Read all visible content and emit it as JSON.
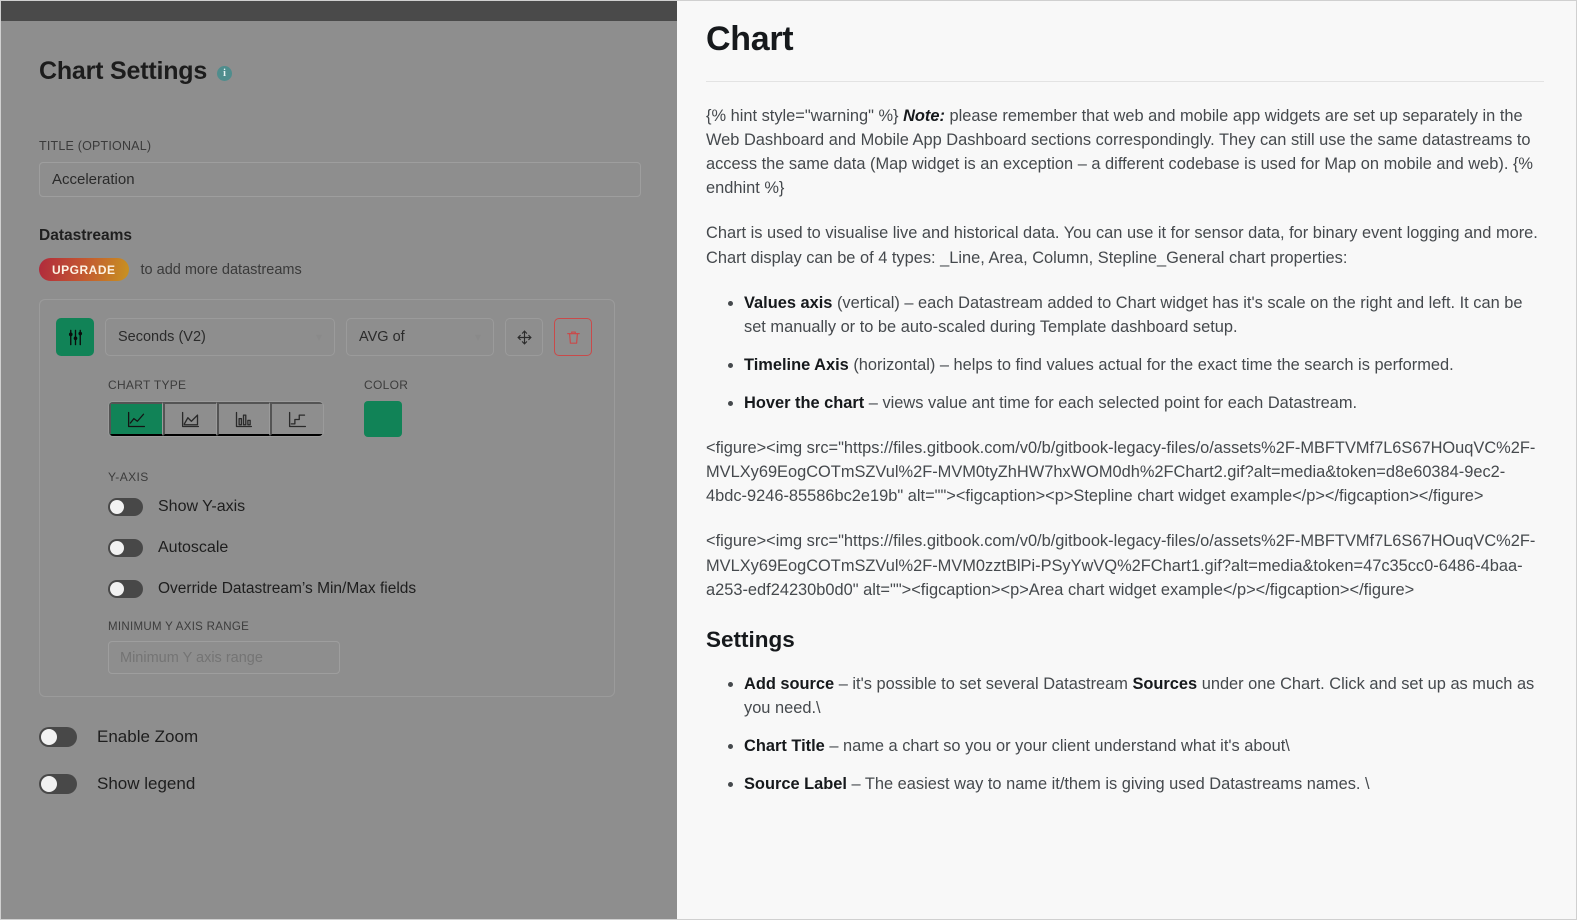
{
  "left_panel": {
    "title": "Chart Settings",
    "info_icon": "info-icon",
    "title_field": {
      "label": "TITLE (OPTIONAL)",
      "value": "Acceleration"
    },
    "datastreams": {
      "heading": "Datastreams",
      "upgrade_badge": "UPGRADE",
      "upgrade_note": "to add more datastreams",
      "row": {
        "settings_icon": "sliders-icon",
        "datastream_select": "Seconds (V2)",
        "aggregation_select": "AVG of",
        "move_icon": "move-icon",
        "delete_icon": "trash-icon"
      },
      "chart_type": {
        "label": "CHART TYPE",
        "options": [
          "line-chart-icon",
          "area-chart-icon",
          "column-chart-icon",
          "stepline-chart-icon"
        ],
        "selected_index": 0
      },
      "color": {
        "label": "COLOR",
        "value": "#118357"
      },
      "y_axis": {
        "label": "Y-AXIS",
        "toggles": [
          {
            "label": "Show Y-axis",
            "on": false
          },
          {
            "label": "Autoscale",
            "on": false
          },
          {
            "label": "Override Datastream’s Min/Max fields",
            "on": false
          }
        ],
        "min_range": {
          "label": "MINIMUM Y AXIS RANGE",
          "value": "",
          "placeholder": "Minimum Y axis range"
        }
      }
    },
    "bottom_toggles": [
      {
        "label": "Enable Zoom",
        "on": false
      },
      {
        "label": "Show legend",
        "on": false
      }
    ]
  },
  "right_panel": {
    "title": "Chart",
    "note_paragraph": {
      "prefix": "{% hint style=\"warning\" %} ",
      "note_label": "Note:",
      "body": " please remember that web and mobile app widgets are set up separately in the Web Dashboard and Mobile App Dashboard sections correspondingly. They can still use the same datastreams to access the same data (Map widget is an exception – a different codebase is used for Map on mobile and web). {% endhint %}"
    },
    "intro_paragraph": "Chart is used to visualise live and historical data. You can use it for sensor data, for binary event logging and more. Chart display can be of 4 types: _Line, Area, Column, Stepline_General chart properties:",
    "properties_list": [
      {
        "term": "Values axis",
        "desc": " (vertical) – each Datastream added to Chart widget has it's scale on the right and left. It can be set manually or to be auto-scaled during Template dashboard setup."
      },
      {
        "term": "Timeline Axis",
        "desc": " (horizontal) – helps to find values actual for the exact time the search is performed."
      },
      {
        "term": "Hover the chart",
        "desc": " – views value ant time for each selected point for each Datastream."
      }
    ],
    "figure_block_1": "<figure><img src=\"https://files.gitbook.com/v0/b/gitbook-legacy-files/o/assets%2F-MBFTVMf7L6S67HOuqVC%2F-MVLXy69EogCOTmSZVul%2F-MVM0tyZhHW7hxWOM0dh%2FChart2.gif?alt=media&token=d8e60384-9ec2-4bdc-9246-85586bc2e19b\" alt=\"\"><figcaption><p>Stepline chart widget example</p></figcaption></figure>",
    "figure_block_2": "<figure><img src=\"https://files.gitbook.com/v0/b/gitbook-legacy-files/o/assets%2F-MBFTVMf7L6S67HOuqVC%2F-MVLXy69EogCOTmSZVul%2F-MVM0zztBlPi-PSyYwVQ%2FChart1.gif?alt=media&token=47c35cc0-6486-4baa-a253-edf24230b0d0\" alt=\"\"><figcaption><p>Area chart widget example</p></figcaption></figure>",
    "settings_heading": "Settings",
    "settings_list": [
      {
        "term": "Add source",
        "desc_before": " – it's possible to set several Datastream ",
        "term2": "Sources",
        "desc_after": " under one Chart. Click and set up as much as you need.\\"
      },
      {
        "term": "Chart Title",
        "desc_before": " – name a chart so you or your client understand what it's about\\",
        "term2": "",
        "desc_after": ""
      },
      {
        "term": "Source Label",
        "desc_before": " – The easiest way to name it/them is giving used Datastreams names. \\",
        "term2": "",
        "desc_after": ""
      }
    ]
  }
}
